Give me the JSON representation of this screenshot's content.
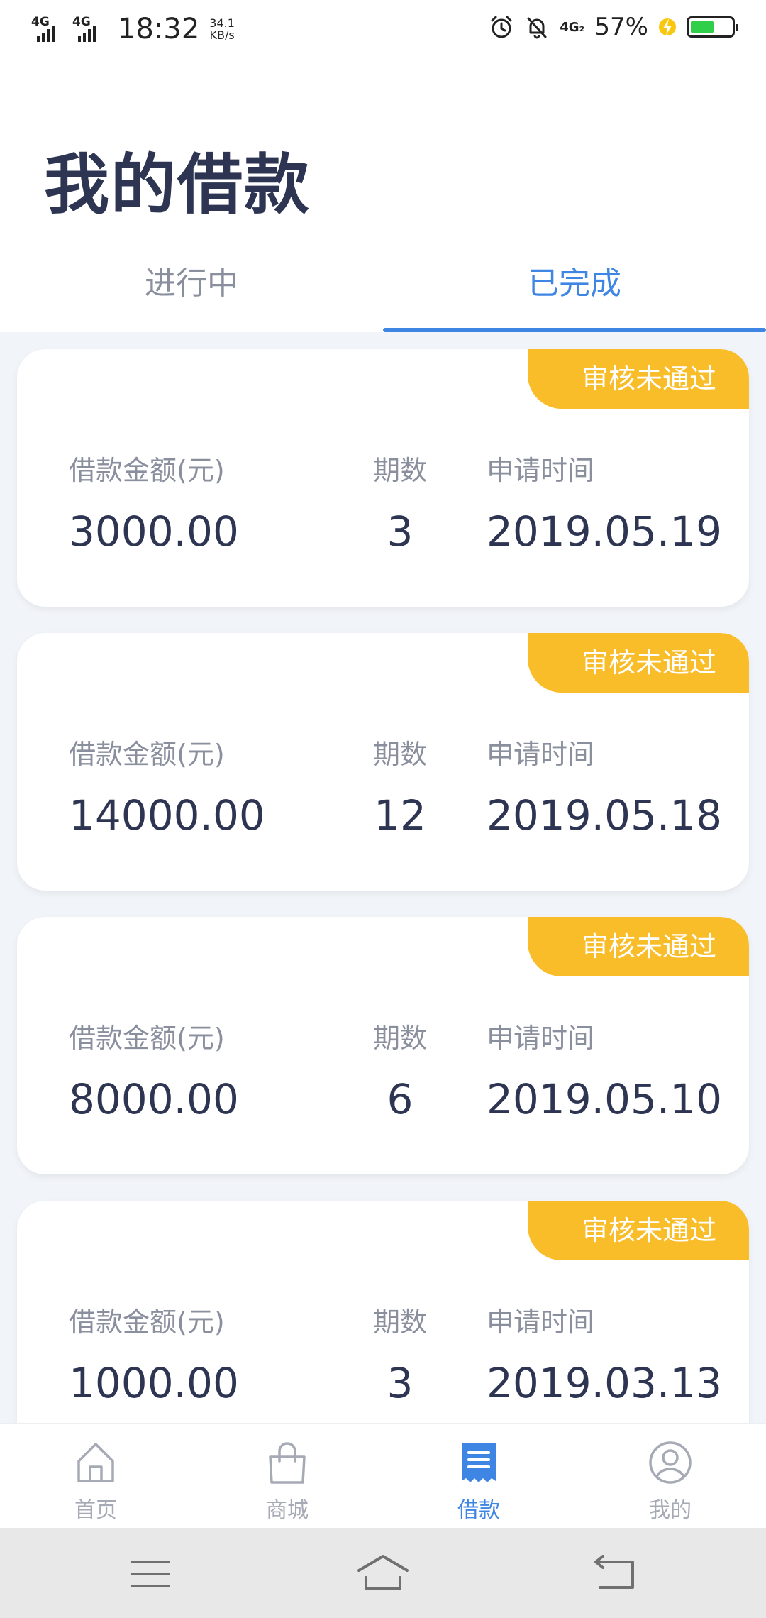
{
  "status_bar": {
    "network_1": "4G",
    "network_2": "4G",
    "time": "18:32",
    "speed_value": "34.1",
    "speed_unit": "KB/s",
    "volte_label": "4G₂",
    "battery_percent": "57%",
    "battery_level": 0.57
  },
  "page": {
    "title": "我的借款"
  },
  "tabs": [
    {
      "label": "进行中",
      "active": false
    },
    {
      "label": "已完成",
      "active": true
    }
  ],
  "labels": {
    "amount": "借款金额(元)",
    "term": "期数",
    "date": "申请时间"
  },
  "loans": [
    {
      "status": "审核未通过",
      "amount": "3000.00",
      "term": "3",
      "date": "2019.05.19"
    },
    {
      "status": "审核未通过",
      "amount": "14000.00",
      "term": "12",
      "date": "2019.05.18"
    },
    {
      "status": "审核未通过",
      "amount": "8000.00",
      "term": "6",
      "date": "2019.05.10"
    },
    {
      "status": "审核未通过",
      "amount": "1000.00",
      "term": "3",
      "date": "2019.03.13"
    }
  ],
  "bottom_nav": [
    {
      "label": "首页",
      "icon": "home-icon",
      "active": false
    },
    {
      "label": "商城",
      "icon": "shopping-bag-icon",
      "active": false
    },
    {
      "label": "借款",
      "icon": "document-icon",
      "active": true
    },
    {
      "label": "我的",
      "icon": "user-icon",
      "active": false
    }
  ],
  "colors": {
    "accent": "#3f86e4",
    "badge": "#f9bd2a",
    "text_dark": "#2d3552",
    "text_muted": "#8a8f9e",
    "list_bg": "#f1f4f8"
  }
}
